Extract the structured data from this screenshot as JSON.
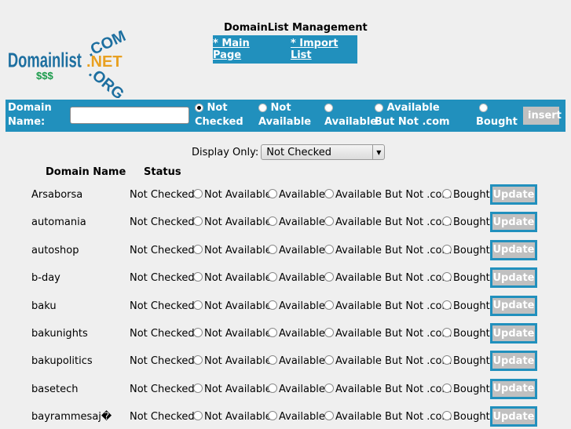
{
  "logo": {
    "text": "Domainlist",
    "sub": "$$$",
    "tlds": [
      ".COM",
      ".NET",
      ".ORG"
    ]
  },
  "header": {
    "title": "DomainList Management",
    "nav": [
      "* Main Page",
      "* Import List"
    ]
  },
  "form": {
    "label": "Domain Name:",
    "domain_value": "",
    "radios": [
      {
        "label": "Not Checked",
        "checked": true
      },
      {
        "label": "Not Available",
        "checked": false
      },
      {
        "label": "Available",
        "checked": false
      },
      {
        "label": "Available But Not .com",
        "checked": false
      },
      {
        "label": "Bought",
        "checked": false
      }
    ],
    "insert": "insert"
  },
  "filter": {
    "label": "Display Only:",
    "selected": "Not Checked"
  },
  "table": {
    "headers": [
      "Domain Name",
      "Status"
    ],
    "options": [
      "Not Available",
      "Available",
      "Available But Not .com",
      "Bought"
    ],
    "update": "Update",
    "rows": [
      {
        "name": "Arsaborsa",
        "status": "Not Checked"
      },
      {
        "name": "automania",
        "status": "Not Checked"
      },
      {
        "name": "autoshop",
        "status": "Not Checked"
      },
      {
        "name": "b-day",
        "status": "Not Checked"
      },
      {
        "name": "baku",
        "status": "Not Checked"
      },
      {
        "name": "bakunights",
        "status": "Not Checked"
      },
      {
        "name": "bakupolitics",
        "status": "Not Checked"
      },
      {
        "name": "basetech",
        "status": "Not Checked"
      },
      {
        "name": "bayrammesaj�",
        "status": "Not Checked"
      }
    ]
  }
}
